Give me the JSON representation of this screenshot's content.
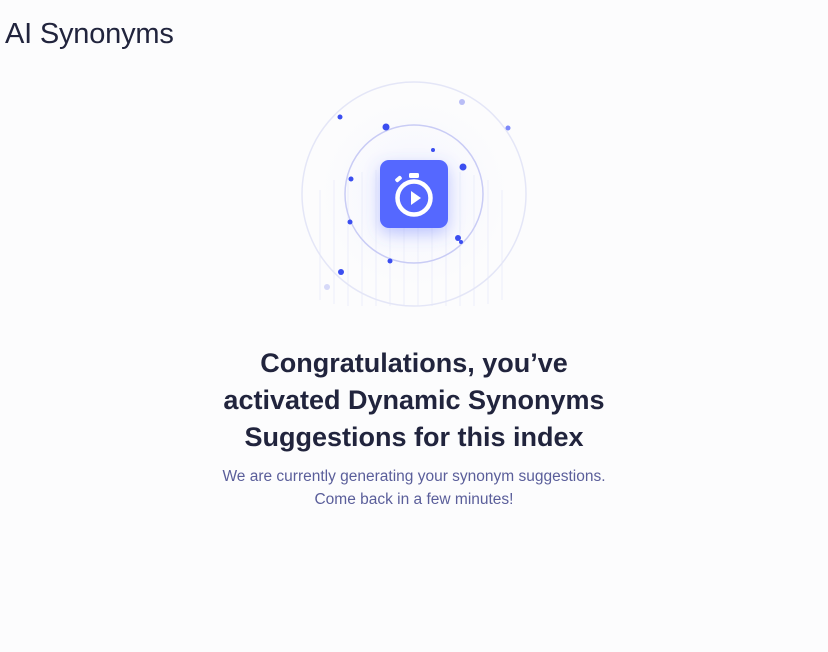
{
  "header": {
    "title": "AI Synonyms"
  },
  "illustration": {
    "icon": "stopwatch-icon",
    "accent_color": "#5468ff",
    "ring_color": "#c9ccf5",
    "dot_color": "#3b4ef0"
  },
  "empty_state": {
    "headline_lines": [
      "Congratulations, you’ve",
      "activated Dynamic Synonyms",
      "Suggestions for this index"
    ],
    "message_lines": [
      "We are currently generating your synonym suggestions.",
      "Come back in a few minutes!"
    ]
  },
  "colors": {
    "background": "#fcfcfd",
    "heading": "#21243d",
    "body_text": "#5a5e9a"
  }
}
